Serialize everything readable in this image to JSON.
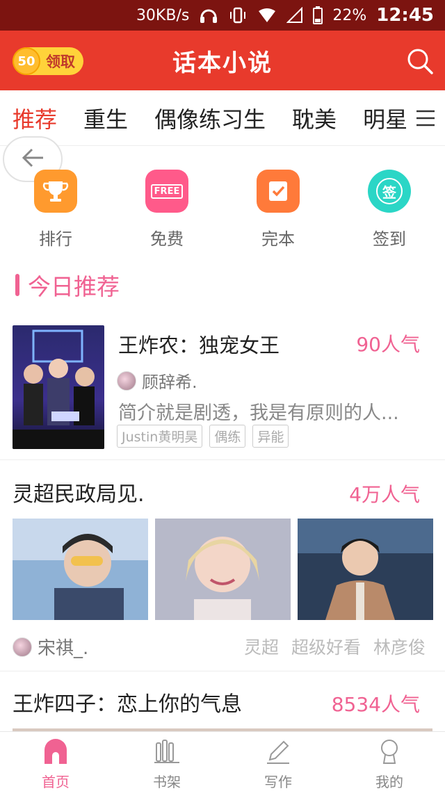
{
  "status_bar": {
    "speed": "30KB/s",
    "battery": "22%",
    "time": "12:45"
  },
  "header": {
    "title": "话本小说",
    "reward_count": "50",
    "reward_label": "领取"
  },
  "tabs": [
    {
      "label": "推荐",
      "active": true
    },
    {
      "label": "重生",
      "active": false
    },
    {
      "label": "偶像练习生",
      "active": false
    },
    {
      "label": "耽美",
      "active": false
    },
    {
      "label": "明星|",
      "active": false
    }
  ],
  "quick_entries": [
    {
      "label": "排行",
      "icon": "trophy-icon",
      "color": "#ff9a2e"
    },
    {
      "label": "免费",
      "icon": "free-sign-icon",
      "color": "#ff5a8a",
      "icon_text": "FREE"
    },
    {
      "label": "完本",
      "icon": "check-doc-icon",
      "color": "#ff7a3a"
    },
    {
      "label": "签到",
      "icon": "checkin-icon",
      "color": "#2bd6c6",
      "icon_text": "签"
    }
  ],
  "section": {
    "title": "今日推荐"
  },
  "book": {
    "title": "王炸农：独宠女王",
    "popularity": "90人气",
    "author": "顾辞希.",
    "description": "简介就是剧透，我是有原则的人...",
    "tags": [
      "Justin黄明昊",
      "偶练",
      "异能"
    ]
  },
  "post": {
    "title": "灵超民政局见.",
    "popularity": "4万人气",
    "author": "宋祺_.",
    "tags": [
      "灵超",
      "超级好看",
      "林彦俊"
    ]
  },
  "next_post": {
    "title": "王炸四子：恋上你的气息",
    "popularity": "8534人气"
  },
  "bottom_nav": [
    {
      "label": "首页",
      "icon": "home-icon",
      "active": true
    },
    {
      "label": "书架",
      "icon": "bookshelf-icon",
      "active": false
    },
    {
      "label": "写作",
      "icon": "pen-icon",
      "active": false
    },
    {
      "label": "我的",
      "icon": "profile-icon",
      "active": false
    }
  ],
  "colors": {
    "brand_red": "#e83a2c",
    "accent_pink": "#f06292",
    "status_bar": "#7c1410"
  }
}
